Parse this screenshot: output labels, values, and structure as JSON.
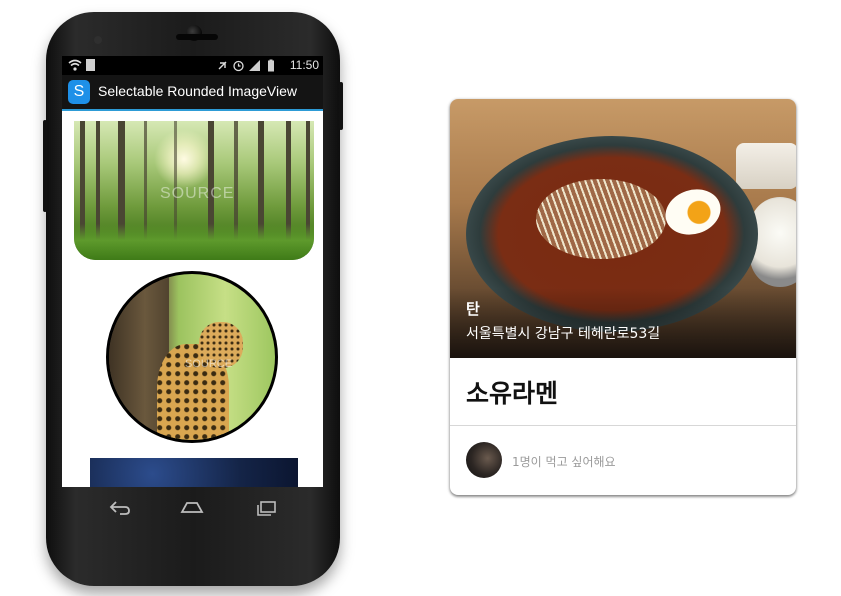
{
  "phone": {
    "status_bar": {
      "time": "11:50",
      "left_icons": [
        "wifi-icon",
        "sim-icon"
      ],
      "right_icons": [
        "mute-icon",
        "alarm-icon",
        "signal-icon",
        "battery-icon"
      ]
    },
    "action_bar": {
      "app_icon_letter": "S",
      "title": "Selectable Rounded ImageView",
      "accent_color": "#2d9bd6"
    },
    "content": {
      "images": [
        "forest-image",
        "cheetah-image",
        "night-sky-image"
      ],
      "watermark_text": "SOURCE"
    },
    "navigation_bar": {
      "buttons": [
        "back-icon",
        "home-icon",
        "recents-icon"
      ]
    }
  },
  "card": {
    "place_name": "탄",
    "address": "서울특별시 강남구 테헤란로53길",
    "dish_name": "소유라멘",
    "want_text": "1명이 먹고 싶어해요"
  }
}
